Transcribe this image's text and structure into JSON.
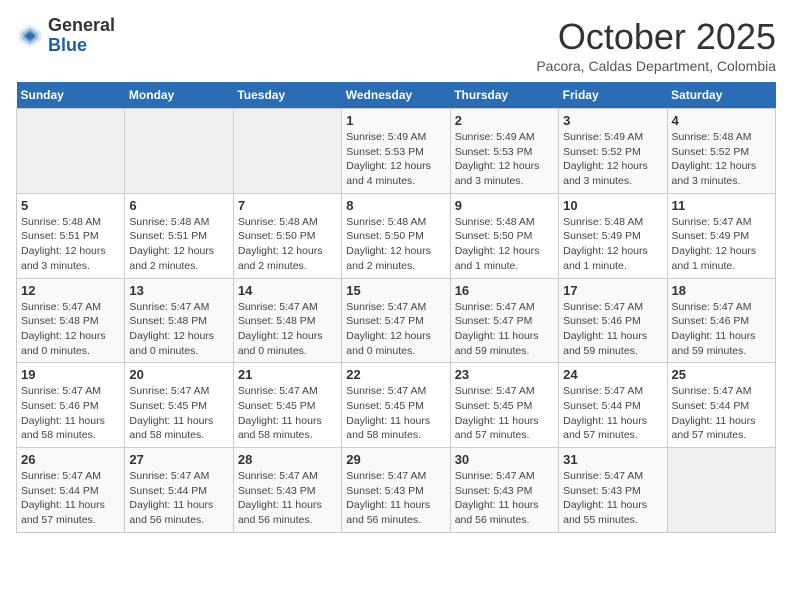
{
  "header": {
    "logo_general": "General",
    "logo_blue": "Blue",
    "month_title": "October 2025",
    "subtitle": "Pacora, Caldas Department, Colombia"
  },
  "days_of_week": [
    "Sunday",
    "Monday",
    "Tuesday",
    "Wednesday",
    "Thursday",
    "Friday",
    "Saturday"
  ],
  "weeks": [
    [
      {
        "day": "",
        "info": ""
      },
      {
        "day": "",
        "info": ""
      },
      {
        "day": "",
        "info": ""
      },
      {
        "day": "1",
        "info": "Sunrise: 5:49 AM\nSunset: 5:53 PM\nDaylight: 12 hours and 4 minutes."
      },
      {
        "day": "2",
        "info": "Sunrise: 5:49 AM\nSunset: 5:53 PM\nDaylight: 12 hours and 3 minutes."
      },
      {
        "day": "3",
        "info": "Sunrise: 5:49 AM\nSunset: 5:52 PM\nDaylight: 12 hours and 3 minutes."
      },
      {
        "day": "4",
        "info": "Sunrise: 5:48 AM\nSunset: 5:52 PM\nDaylight: 12 hours and 3 minutes."
      }
    ],
    [
      {
        "day": "5",
        "info": "Sunrise: 5:48 AM\nSunset: 5:51 PM\nDaylight: 12 hours and 3 minutes."
      },
      {
        "day": "6",
        "info": "Sunrise: 5:48 AM\nSunset: 5:51 PM\nDaylight: 12 hours and 2 minutes."
      },
      {
        "day": "7",
        "info": "Sunrise: 5:48 AM\nSunset: 5:50 PM\nDaylight: 12 hours and 2 minutes."
      },
      {
        "day": "8",
        "info": "Sunrise: 5:48 AM\nSunset: 5:50 PM\nDaylight: 12 hours and 2 minutes."
      },
      {
        "day": "9",
        "info": "Sunrise: 5:48 AM\nSunset: 5:50 PM\nDaylight: 12 hours and 1 minute."
      },
      {
        "day": "10",
        "info": "Sunrise: 5:48 AM\nSunset: 5:49 PM\nDaylight: 12 hours and 1 minute."
      },
      {
        "day": "11",
        "info": "Sunrise: 5:47 AM\nSunset: 5:49 PM\nDaylight: 12 hours and 1 minute."
      }
    ],
    [
      {
        "day": "12",
        "info": "Sunrise: 5:47 AM\nSunset: 5:48 PM\nDaylight: 12 hours and 0 minutes."
      },
      {
        "day": "13",
        "info": "Sunrise: 5:47 AM\nSunset: 5:48 PM\nDaylight: 12 hours and 0 minutes."
      },
      {
        "day": "14",
        "info": "Sunrise: 5:47 AM\nSunset: 5:48 PM\nDaylight: 12 hours and 0 minutes."
      },
      {
        "day": "15",
        "info": "Sunrise: 5:47 AM\nSunset: 5:47 PM\nDaylight: 12 hours and 0 minutes."
      },
      {
        "day": "16",
        "info": "Sunrise: 5:47 AM\nSunset: 5:47 PM\nDaylight: 11 hours and 59 minutes."
      },
      {
        "day": "17",
        "info": "Sunrise: 5:47 AM\nSunset: 5:46 PM\nDaylight: 11 hours and 59 minutes."
      },
      {
        "day": "18",
        "info": "Sunrise: 5:47 AM\nSunset: 5:46 PM\nDaylight: 11 hours and 59 minutes."
      }
    ],
    [
      {
        "day": "19",
        "info": "Sunrise: 5:47 AM\nSunset: 5:46 PM\nDaylight: 11 hours and 58 minutes."
      },
      {
        "day": "20",
        "info": "Sunrise: 5:47 AM\nSunset: 5:45 PM\nDaylight: 11 hours and 58 minutes."
      },
      {
        "day": "21",
        "info": "Sunrise: 5:47 AM\nSunset: 5:45 PM\nDaylight: 11 hours and 58 minutes."
      },
      {
        "day": "22",
        "info": "Sunrise: 5:47 AM\nSunset: 5:45 PM\nDaylight: 11 hours and 58 minutes."
      },
      {
        "day": "23",
        "info": "Sunrise: 5:47 AM\nSunset: 5:45 PM\nDaylight: 11 hours and 57 minutes."
      },
      {
        "day": "24",
        "info": "Sunrise: 5:47 AM\nSunset: 5:44 PM\nDaylight: 11 hours and 57 minutes."
      },
      {
        "day": "25",
        "info": "Sunrise: 5:47 AM\nSunset: 5:44 PM\nDaylight: 11 hours and 57 minutes."
      }
    ],
    [
      {
        "day": "26",
        "info": "Sunrise: 5:47 AM\nSunset: 5:44 PM\nDaylight: 11 hours and 57 minutes."
      },
      {
        "day": "27",
        "info": "Sunrise: 5:47 AM\nSunset: 5:44 PM\nDaylight: 11 hours and 56 minutes."
      },
      {
        "day": "28",
        "info": "Sunrise: 5:47 AM\nSunset: 5:43 PM\nDaylight: 11 hours and 56 minutes."
      },
      {
        "day": "29",
        "info": "Sunrise: 5:47 AM\nSunset: 5:43 PM\nDaylight: 11 hours and 56 minutes."
      },
      {
        "day": "30",
        "info": "Sunrise: 5:47 AM\nSunset: 5:43 PM\nDaylight: 11 hours and 56 minutes."
      },
      {
        "day": "31",
        "info": "Sunrise: 5:47 AM\nSunset: 5:43 PM\nDaylight: 11 hours and 55 minutes."
      },
      {
        "day": "",
        "info": ""
      }
    ]
  ]
}
